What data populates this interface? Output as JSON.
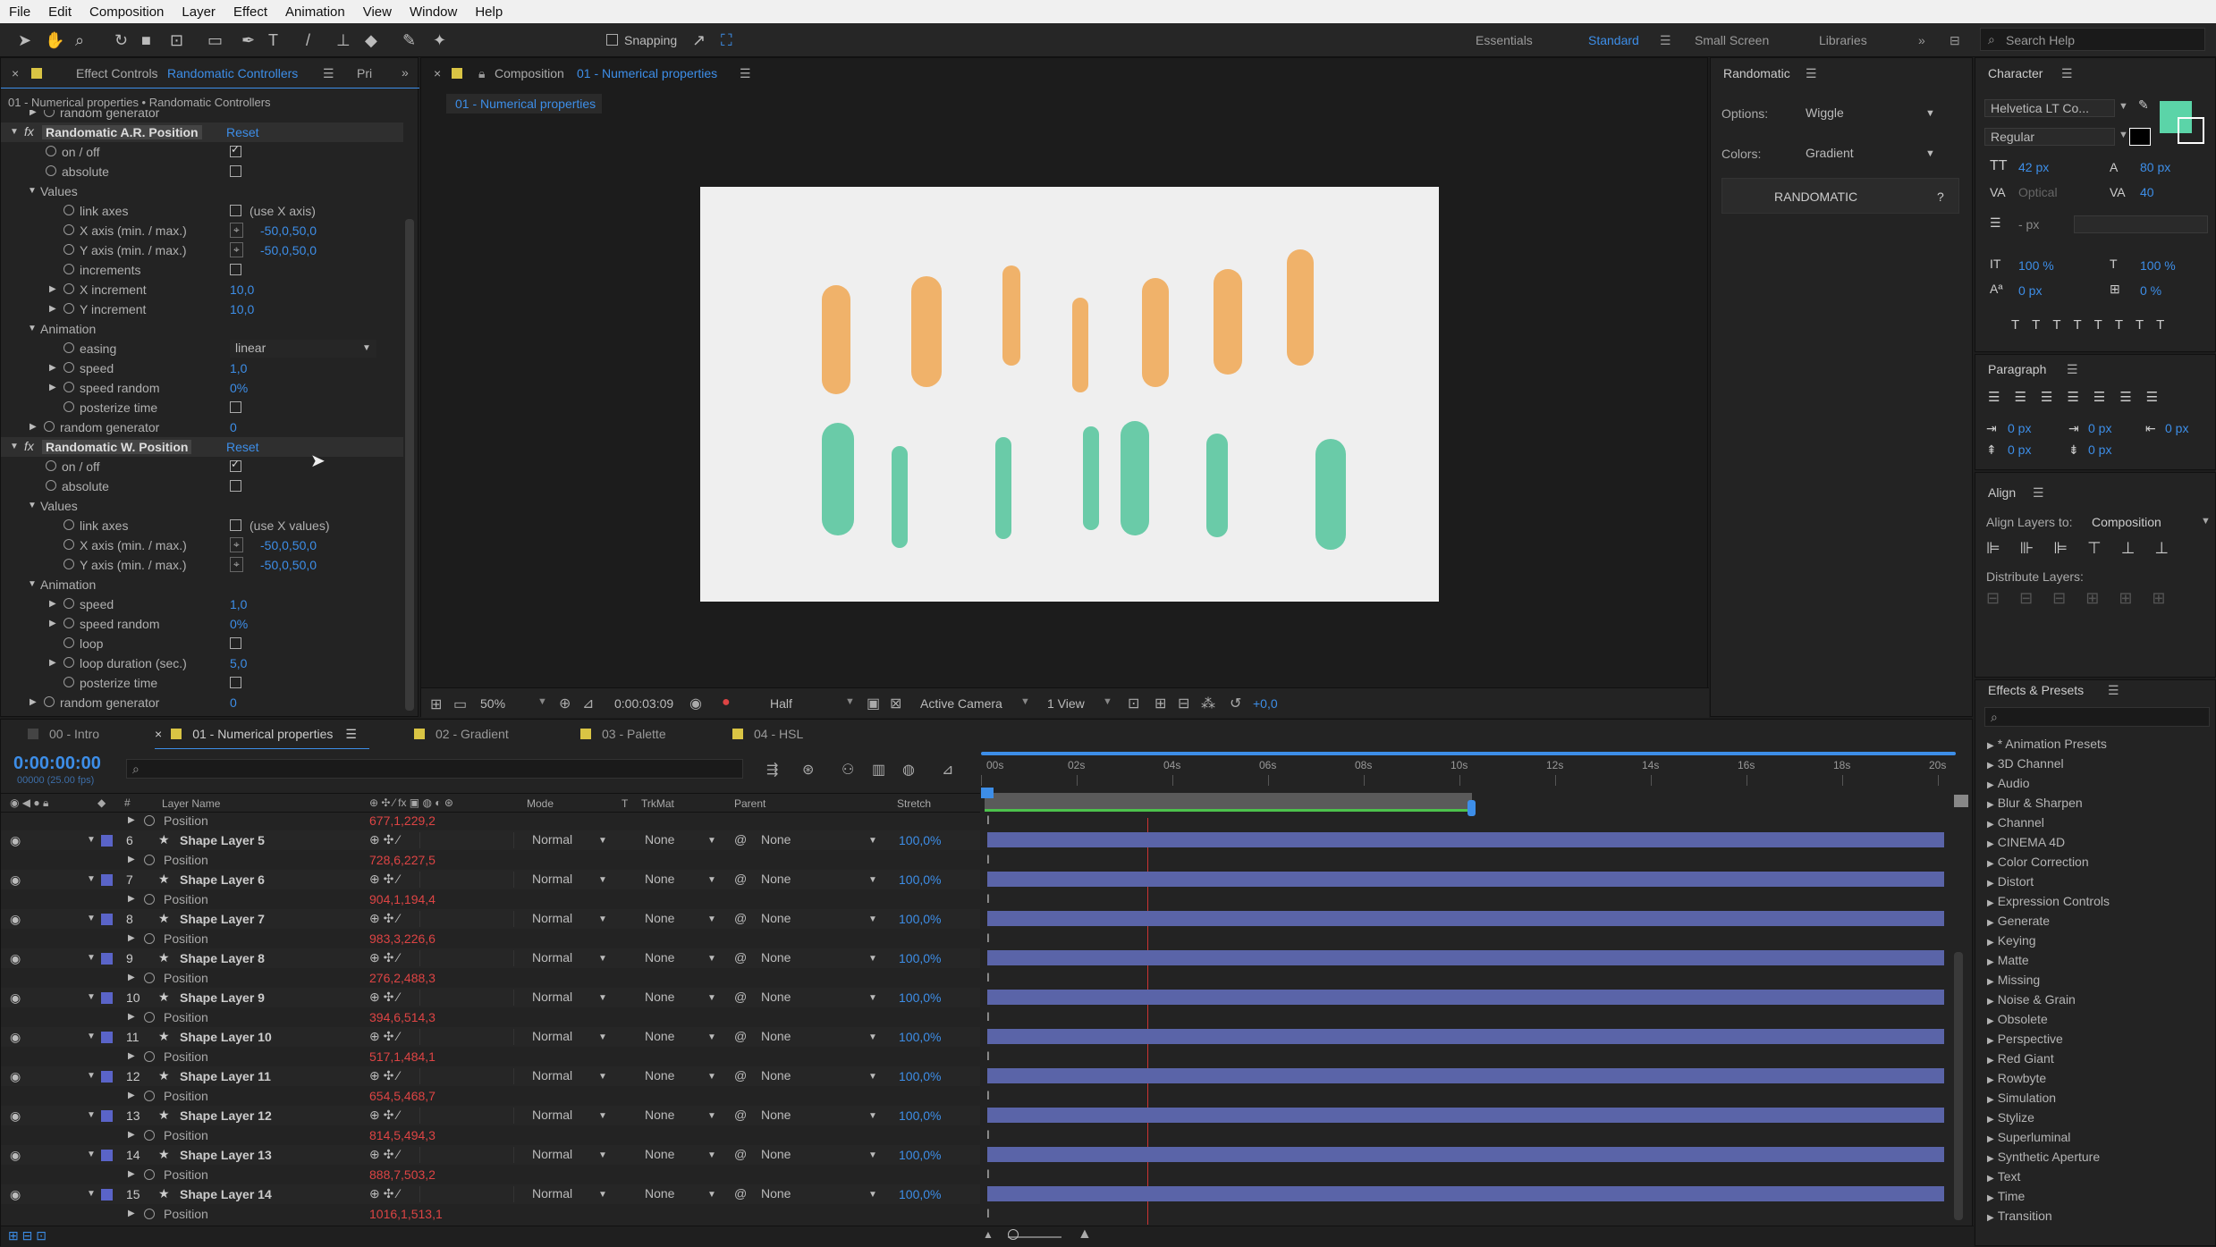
{
  "menu": [
    "File",
    "Edit",
    "Composition",
    "Layer",
    "Effect",
    "Animation",
    "View",
    "Window",
    "Help"
  ],
  "toolbar": {
    "snapping": "Snapping",
    "workspaces": [
      "Essentials",
      "Standard",
      "Small Screen",
      "Libraries"
    ],
    "active_workspace": "Standard",
    "search_placeholder": "Search Help"
  },
  "effect_controls": {
    "tab_prefix": "Effect Controls",
    "tab_name": "Randomatic Controllers",
    "tab2": "Pri",
    "breadcrumb": "01 - Numerical properties • Randomatic Controllers",
    "rows": [
      {
        "label": "random generator",
        "value": "",
        "indent": 1,
        "type": "tw"
      },
      {
        "label": "Randomatic A.R. Position",
        "reset": "Reset",
        "type": "fx"
      },
      {
        "label": "on / off",
        "type": "cb",
        "checked": true,
        "indent": 2
      },
      {
        "label": "absolute",
        "type": "cb",
        "checked": false,
        "indent": 2
      },
      {
        "label": "Values",
        "type": "group",
        "indent": 1
      },
      {
        "label": "link axes",
        "type": "cb",
        "checked": false,
        "extra": "(use X axis)",
        "indent": 3
      },
      {
        "label": "X axis (min. / max.)",
        "type": "pt",
        "value": "-50,0,50,0",
        "indent": 3
      },
      {
        "label": "Y axis (min. / max.)",
        "type": "pt",
        "value": "-50,0,50,0",
        "indent": 3
      },
      {
        "label": "increments",
        "type": "cb",
        "checked": false,
        "indent": 3
      },
      {
        "label": "X increment",
        "type": "tw",
        "value": "10,0",
        "indent": 2
      },
      {
        "label": "Y increment",
        "type": "tw",
        "value": "10,0",
        "indent": 2
      },
      {
        "label": "Animation",
        "type": "group",
        "indent": 1
      },
      {
        "label": "easing",
        "type": "dd",
        "value": "linear",
        "indent": 3
      },
      {
        "label": "speed",
        "type": "tw",
        "value": "1,0",
        "indent": 2
      },
      {
        "label": "speed random",
        "type": "tw",
        "value": "0%",
        "indent": 2
      },
      {
        "label": "posterize time",
        "type": "cb",
        "checked": false,
        "indent": 3
      },
      {
        "label": "random generator",
        "type": "tw",
        "value": "0",
        "indent": 1
      },
      {
        "label": "Randomatic W. Position",
        "reset": "Reset",
        "type": "fx"
      },
      {
        "label": "on / off",
        "type": "cb",
        "checked": true,
        "indent": 2
      },
      {
        "label": "absolute",
        "type": "cb",
        "checked": false,
        "indent": 2
      },
      {
        "label": "Values",
        "type": "group",
        "indent": 1
      },
      {
        "label": "link axes",
        "type": "cb",
        "checked": false,
        "extra": "(use X values)",
        "indent": 3
      },
      {
        "label": "X axis (min. / max.)",
        "type": "pt",
        "value": "-50,0,50,0",
        "indent": 3
      },
      {
        "label": "Y axis (min. / max.)",
        "type": "pt",
        "value": "-50,0,50,0",
        "indent": 3
      },
      {
        "label": "Animation",
        "type": "group",
        "indent": 1
      },
      {
        "label": "speed",
        "type": "tw",
        "value": "1,0",
        "indent": 2
      },
      {
        "label": "speed random",
        "type": "tw",
        "value": "0%",
        "indent": 2
      },
      {
        "label": "loop",
        "type": "cb",
        "checked": false,
        "indent": 3
      },
      {
        "label": "loop duration (sec.)",
        "type": "tw",
        "value": "5,0",
        "indent": 2
      },
      {
        "label": "posterize time",
        "type": "cb",
        "checked": false,
        "indent": 3
      },
      {
        "label": "random generator",
        "type": "tw",
        "value": "0",
        "indent": 1
      }
    ]
  },
  "composition": {
    "tab_prefix": "Composition",
    "tab_name": "01 - Numerical properties",
    "subtab": "01 - Numerical properties",
    "footer": {
      "zoom": "50%",
      "time": "0:00:03:09",
      "resolution": "Half",
      "camera": "Active Camera",
      "view": "1 View",
      "exposure": "+0,0"
    },
    "colors": {
      "orange": "#f0b26a",
      "teal": "#6acba8",
      "canvas": "#efefef"
    }
  },
  "randomatic": {
    "title": "Randomatic",
    "options_label": "Options:",
    "options_value": "Wiggle",
    "colors_label": "Colors:",
    "colors_value": "Gradient",
    "button": "RANDOMATIC",
    "help": "?"
  },
  "character": {
    "title": "Character",
    "font": "Helvetica LT Co...",
    "style": "Regular",
    "size": "42 px",
    "leading": "80 px",
    "kerning": "Optical",
    "tracking": "40",
    "stroke": "- px",
    "vscale": "100 %",
    "hscale": "100 %",
    "baseline": "0 px",
    "tsume": "0 %",
    "fill_color": "#5bd4a8"
  },
  "paragraph": {
    "title": "Paragraph",
    "indent_left": "0 px",
    "indent_first": "0 px",
    "indent_right": "0 px",
    "space_before": "0 px",
    "space_after": "0 px"
  },
  "align": {
    "title": "Align",
    "align_to_label": "Align Layers to:",
    "align_to": "Composition",
    "distribute": "Distribute Layers:"
  },
  "effects_presets": {
    "title": "Effects & Presets",
    "items": [
      "* Animation Presets",
      "3D Channel",
      "Audio",
      "Blur & Sharpen",
      "Channel",
      "CINEMA 4D",
      "Color Correction",
      "Distort",
      "Expression Controls",
      "Generate",
      "Keying",
      "Matte",
      "Missing",
      "Noise & Grain",
      "Obsolete",
      "Perspective",
      "Red Giant",
      "Rowbyte",
      "Simulation",
      "Stylize",
      "Superluminal",
      "Synthetic Aperture",
      "Text",
      "Time",
      "Transition"
    ]
  },
  "timeline": {
    "tabs": [
      "00 - Intro",
      "01 - Numerical properties",
      "02 - Gradient",
      "03 - Palette",
      "04 - HSL"
    ],
    "active_tab": "01 - Numerical properties",
    "timecode": "0:00:00:00",
    "fps": "00000 (25.00 fps)",
    "headers": {
      "layer_name": "Layer Name",
      "mode": "Mode",
      "t": "T",
      "trkmat": "TrkMat",
      "parent": "Parent",
      "stretch": "Stretch"
    },
    "ruler": [
      "00s",
      "02s",
      "04s",
      "06s",
      "08s",
      "10s",
      "12s",
      "14s",
      "16s",
      "18s",
      "20s"
    ],
    "top_position": "677,1,229,2",
    "layers": [
      {
        "num": "6",
        "name": "Shape Layer 5",
        "pos": "728,6,227,5"
      },
      {
        "num": "7",
        "name": "Shape Layer 6",
        "pos": "904,1,194,4"
      },
      {
        "num": "8",
        "name": "Shape Layer 7",
        "pos": "983,3,226,6"
      },
      {
        "num": "9",
        "name": "Shape Layer 8",
        "pos": "276,2,488,3"
      },
      {
        "num": "10",
        "name": "Shape Layer 9",
        "pos": "394,6,514,3"
      },
      {
        "num": "11",
        "name": "Shape Layer 10",
        "pos": "517,1,484,1"
      },
      {
        "num": "12",
        "name": "Shape Layer 11",
        "pos": "654,5,468,7"
      },
      {
        "num": "13",
        "name": "Shape Layer 12",
        "pos": "814,5,494,3"
      },
      {
        "num": "14",
        "name": "Shape Layer 13",
        "pos": "888,7,503,2"
      },
      {
        "num": "15",
        "name": "Shape Layer 14",
        "pos": "1016,1,513,1"
      }
    ],
    "position_label": "Position",
    "mode": "Normal",
    "trkmat": "None",
    "parent": "None",
    "stretch": "100,0%"
  }
}
